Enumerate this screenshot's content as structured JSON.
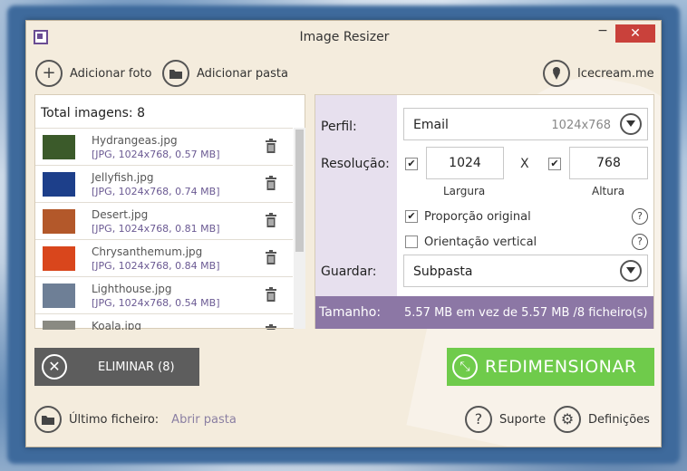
{
  "window": {
    "title": "Image Resizer",
    "minimize_glyph": "−",
    "close_glyph": "✕"
  },
  "toolbar": {
    "add_photo": "Adicionar foto",
    "add_folder": "Adicionar pasta",
    "brand": "Icecream.me"
  },
  "files": {
    "total_label": "Total imagens: 8",
    "items": [
      {
        "name": "Hydrangeas.jpg",
        "meta": "[JPG, 1024x768, 0.57 MB]",
        "thumb_color": "#3b5a2a"
      },
      {
        "name": "Jellyfish.jpg",
        "meta": "[JPG, 1024x768, 0.74 MB]",
        "thumb_color": "#1d3f8a"
      },
      {
        "name": "Desert.jpg",
        "meta": "[JPG, 1024x768, 0.81 MB]",
        "thumb_color": "#b3582a"
      },
      {
        "name": "Chrysanthemum.jpg",
        "meta": "[JPG, 1024x768, 0.84 MB]",
        "thumb_color": "#d9461c"
      },
      {
        "name": "Lighthouse.jpg",
        "meta": "[JPG, 1024x768, 0.54 MB]",
        "thumb_color": "#6e7f96"
      },
      {
        "name": "Koala.jpg",
        "meta": "",
        "thumb_color": "#8a8a82"
      }
    ]
  },
  "settings": {
    "profile_label": "Perfil:",
    "profile_value": "Email",
    "profile_hint": "1024x768",
    "resolution_label": "Resolução:",
    "width_value": "1024",
    "height_value": "768",
    "times": "X",
    "width_caption": "Largura",
    "height_caption": "Altura",
    "keep_ratio_label": "Proporção original",
    "keep_ratio_checked": true,
    "vertical_label": "Orientação vertical",
    "vertical_checked": false,
    "save_label": "Guardar:",
    "save_value": "Subpasta",
    "help": "?"
  },
  "size": {
    "label": "Tamanho:",
    "value": "5.57 MB em vez de 5.57 MB /8 ficheiro(s)"
  },
  "actions": {
    "delete": "ELIMINAR (8)",
    "resize": "REDIMENSIONAR"
  },
  "footer": {
    "last_file": "Último ficheiro:",
    "open_folder": "Abrir pasta",
    "support": "Suporte",
    "settings": "Definições"
  },
  "colors": {
    "accent_purple": "#8c77a5",
    "resize_green": "#6fcb4b",
    "delete_gray": "#5d5d5d",
    "close_red": "#c9413b"
  }
}
